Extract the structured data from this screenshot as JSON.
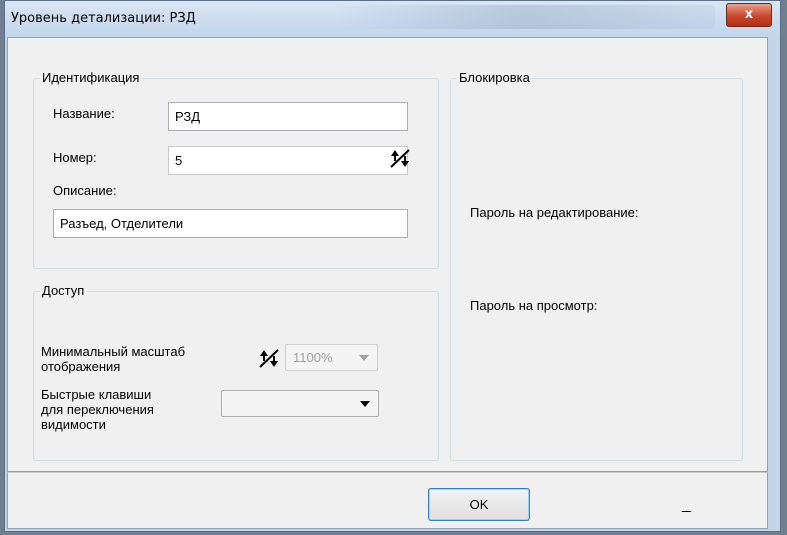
{
  "window": {
    "title": "Уровень детализации: РЗД",
    "close_glyph": "x"
  },
  "identification": {
    "group_label": "Идентификация",
    "name_label": "Название:",
    "name_value": "РЗД",
    "number_label": "Номер:",
    "number_value": "5",
    "description_label": "Описание:",
    "description_value": "Разъед, Отделители"
  },
  "access": {
    "group_label": "Доступ",
    "min_scale_label_line1": "Минимальный масштаб",
    "min_scale_label_line2": "отображения",
    "min_scale_value": "1100%",
    "hotkeys_label_line1": "Быстрые клавиши",
    "hotkeys_label_line2": "для переключения",
    "hotkeys_label_line3": "видимости",
    "hotkeys_value": ""
  },
  "lock": {
    "group_label": "Блокировка",
    "edit_password_label": "Пароль на редактирование:",
    "view_password_label": "Пароль на просмотр:"
  },
  "footer": {
    "ok_label": "OK",
    "trailing_text": "_"
  },
  "icons": {
    "spin": "spin-updown-icon",
    "close": "close-icon",
    "dropdown": "chevron-down-icon"
  }
}
